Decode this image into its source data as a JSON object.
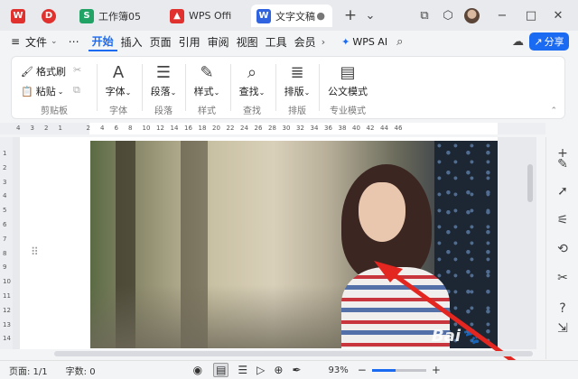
{
  "tabs": [
    {
      "label": "",
      "badge": "",
      "color": "#e0312e"
    },
    {
      "label": "",
      "badge": "",
      "color": "#e0312e"
    },
    {
      "label": "工作簿05",
      "badge": "S",
      "color": "#21a366"
    },
    {
      "label": "WPS Offi",
      "badge": "",
      "color": "#e0312e"
    },
    {
      "label": "文字文稿",
      "badge": "W",
      "color": "#2f63e0"
    }
  ],
  "titlebar": {
    "new_tab": "+",
    "dropdown": "⌄"
  },
  "menu": {
    "file": "文件",
    "more": "⋯",
    "items": [
      "开始",
      "插入",
      "页面",
      "引用",
      "审阅",
      "视图",
      "工具",
      "会员"
    ],
    "wps_ai": "WPS AI",
    "share": "分享"
  },
  "ribbon": {
    "format_painter": "格式刷",
    "paste": "粘贴",
    "clipboard_group": "剪贴板",
    "font": "字体",
    "font_group": "字体",
    "paragraph": "段落",
    "paragraph_group": "段落",
    "style": "样式",
    "style_group": "样式",
    "find": "查找",
    "find_group": "查找",
    "layout": "排版",
    "layout_group": "排版",
    "official_doc": "公文模式",
    "pro_group": "专业模式"
  },
  "ruler": {
    "h_ticks": [
      "4",
      "3",
      "2",
      "1",
      "",
      "2",
      "4",
      "6",
      "8",
      "10",
      "12",
      "14",
      "16",
      "18",
      "20",
      "22",
      "24",
      "26",
      "28",
      "30",
      "32",
      "34",
      "36",
      "38",
      "40",
      "42",
      "44",
      "46"
    ],
    "v_ticks": [
      "1",
      "2",
      "3",
      "4",
      "5",
      "6",
      "7",
      "8",
      "9",
      "10",
      "11",
      "12",
      "13",
      "14"
    ]
  },
  "status": {
    "page": "页面: 1/1",
    "words": "字数: 0",
    "zoom": "93%",
    "minus": "−",
    "plus": "+"
  },
  "watermark": "Bai",
  "colors": {
    "accent": "#1a6bf2",
    "arrow": "#e3261f"
  }
}
